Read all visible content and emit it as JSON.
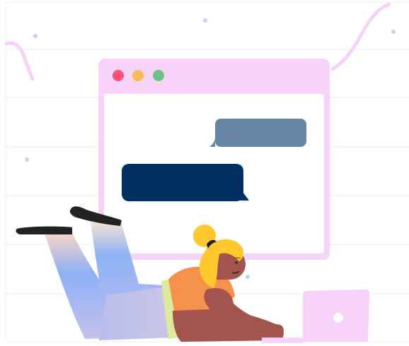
{
  "illustration": {
    "colors": {
      "background": "#ffffff",
      "grid_line": "#eef3f8",
      "dots": "#c2d4ea",
      "squiggle": "#f6d3f6",
      "window_frame": "#f7d3f7",
      "window_body": "#ffffff",
      "dot_red": "#ff4f72",
      "dot_yellow": "#f6bb5a",
      "dot_green": "#6fbf89",
      "bubble_incoming": "#6586a5",
      "bubble_outgoing": "#003061",
      "hair": "#ffc82f",
      "skin": "#a4544f",
      "shirt": "#f6914b",
      "laptop": "#f8d2f8",
      "shoe": "#222222"
    },
    "icons": [
      "chat-window",
      "laptop-icon",
      "person-lying-figure"
    ]
  }
}
